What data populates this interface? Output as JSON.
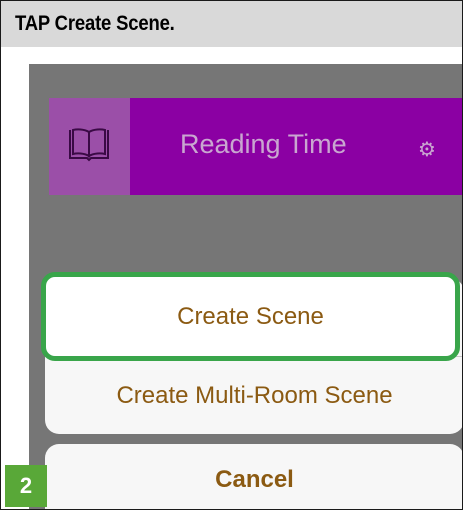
{
  "instruction": {
    "text": "TAP Create Scene."
  },
  "scene": {
    "name": "Reading Time",
    "icon": "book-icon",
    "settings_icon": "gear-icon",
    "color": "#8b00a3"
  },
  "action_sheet": {
    "options": [
      {
        "label": "Create Scene"
      },
      {
        "label": "Create Multi-Room Scene"
      }
    ],
    "cancel_label": "Cancel",
    "text_color": "#8b5a12"
  },
  "highlight": {
    "color": "#39a54a",
    "target": "Create Scene"
  },
  "step": {
    "number": "2",
    "color": "#59a838"
  }
}
